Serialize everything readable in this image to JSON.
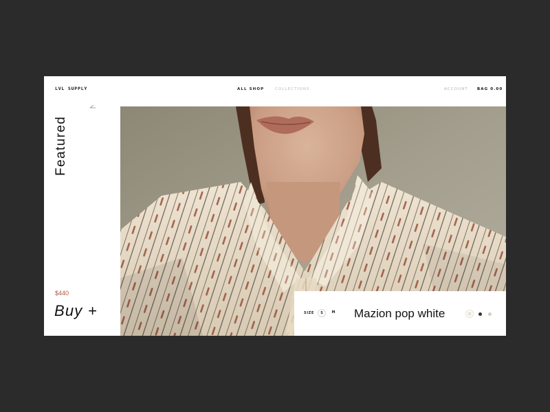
{
  "nav": {
    "logo": "LVL SUPPLY",
    "links": [
      "ALL SHOP",
      "COLLECTIONS"
    ],
    "account": "ACCOUNT",
    "bag": "BAG 0.00"
  },
  "hero": {
    "section_title": "Featured",
    "price": "$440",
    "buy_label": "Buy +",
    "back_icon": "arrow-left-icon"
  },
  "product": {
    "size_label": "SIZE",
    "sizes": [
      "S",
      "M"
    ],
    "selected_size": "S",
    "name": "Mazion pop white",
    "swatches": [
      "#ece6d4",
      "#333333",
      "#d7cfb4"
    ],
    "selected_swatch": 0
  },
  "colors": {
    "background": "#2b2b2b",
    "card": "#ffffff",
    "price_accent": "#b5533a",
    "inactive_link": "#c3b8a6"
  }
}
